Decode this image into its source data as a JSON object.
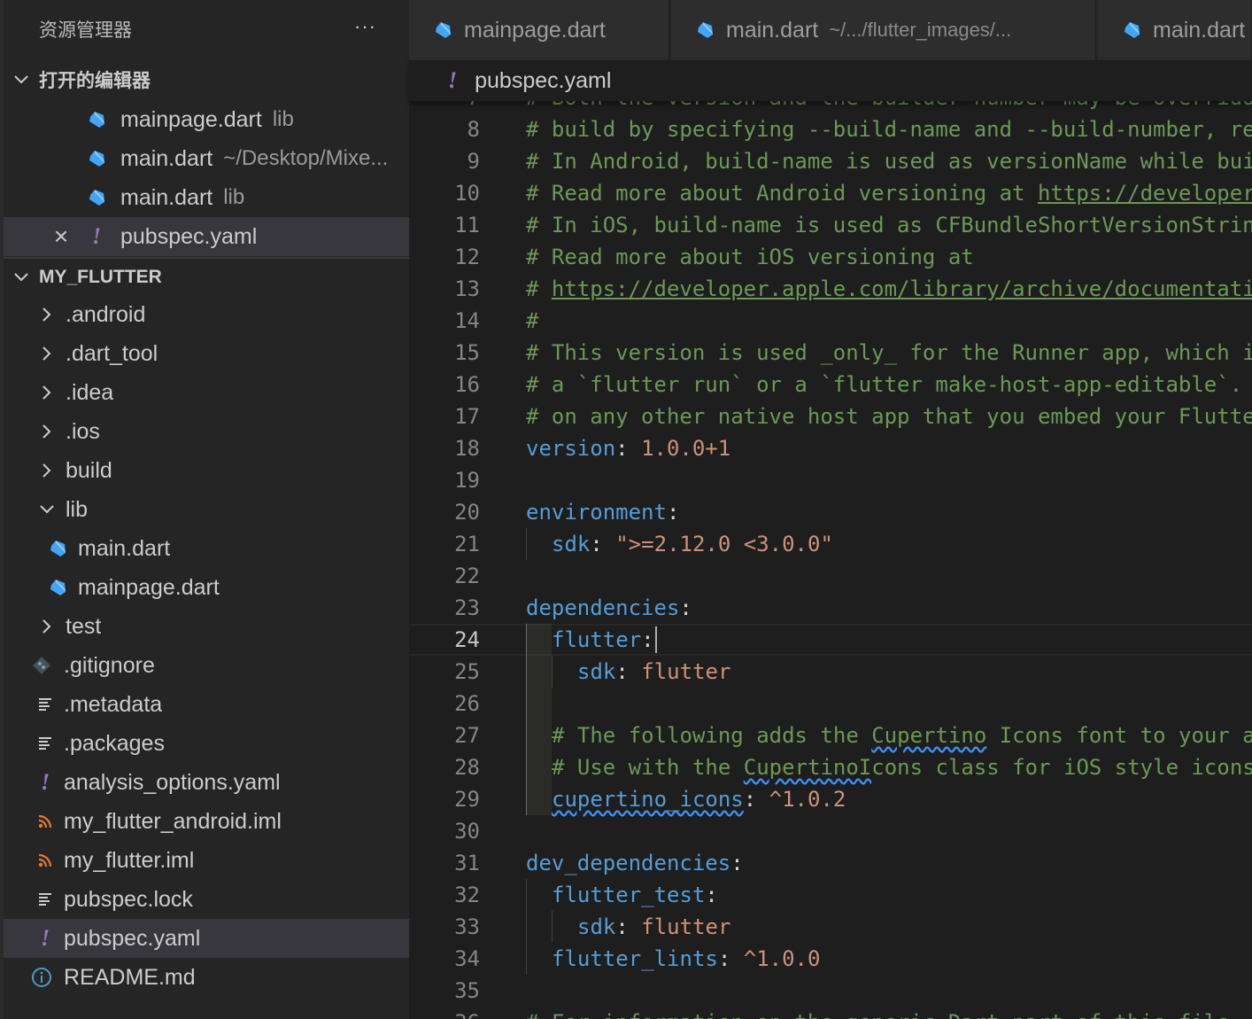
{
  "sidebar": {
    "title": "资源管理器",
    "more": "···",
    "open_editors": {
      "label": "打开的编辑器",
      "items": [
        {
          "name": "mainpage.dart",
          "desc": "lib",
          "icon": "dart-icon"
        },
        {
          "name": "main.dart",
          "desc": "~/Desktop/Mixe...",
          "icon": "dart-icon"
        },
        {
          "name": "main.dart",
          "desc": "lib",
          "icon": "dart-icon"
        },
        {
          "name": "pubspec.yaml",
          "desc": "",
          "icon": "yaml-icon",
          "glyph": "!",
          "close": "×"
        }
      ]
    },
    "project": {
      "label": "MY_FLUTTER",
      "items": [
        {
          "name": ".android",
          "type": "folder"
        },
        {
          "name": ".dart_tool",
          "type": "folder"
        },
        {
          "name": ".idea",
          "type": "folder"
        },
        {
          "name": ".ios",
          "type": "folder"
        },
        {
          "name": "build",
          "type": "folder"
        },
        {
          "name": "lib",
          "type": "folder-open"
        },
        {
          "name": "main.dart",
          "type": "dart"
        },
        {
          "name": "mainpage.dart",
          "type": "dart"
        },
        {
          "name": "test",
          "type": "folder"
        },
        {
          "name": ".gitignore",
          "type": "git"
        },
        {
          "name": ".metadata",
          "type": "lines"
        },
        {
          "name": ".packages",
          "type": "lines"
        },
        {
          "name": "analysis_options.yaml",
          "type": "yaml"
        },
        {
          "name": "my_flutter_android.iml",
          "type": "rss"
        },
        {
          "name": "my_flutter.iml",
          "type": "rss"
        },
        {
          "name": "pubspec.lock",
          "type": "lines"
        },
        {
          "name": "pubspec.yaml",
          "type": "yaml"
        },
        {
          "name": "README.md",
          "type": "info"
        }
      ]
    }
  },
  "tabs": [
    {
      "label": "mainpage.dart",
      "desc": ""
    },
    {
      "label": "main.dart",
      "desc": "~/.../flutter_images/..."
    },
    {
      "label": "main.dart",
      "desc": ""
    }
  ],
  "breadcrumb": {
    "glyph": "!",
    "file": "pubspec.yaml"
  },
  "editor": {
    "lines": [
      {
        "n": "7",
        "code": "# Both the version and the builder number may be overridden"
      },
      {
        "n": "8",
        "code": "# build by specifying --build-name and --build-number, re"
      },
      {
        "n": "9",
        "code": "# In Android, build-name is used as versionName while bui"
      },
      {
        "n": "10",
        "code": "# Read more about Android versioning at ",
        "link": "https://developer"
      },
      {
        "n": "11",
        "code": "# In iOS, build-name is used as CFBundleShortVersionStrin"
      },
      {
        "n": "12",
        "code": "# Read more about iOS versioning at"
      },
      {
        "n": "13",
        "code": "# ",
        "link": "https://developer.apple.com/library/archive/documentati"
      },
      {
        "n": "14",
        "code": "#"
      },
      {
        "n": "15",
        "code": "# This version is used _only_ for the Runner app, which i"
      },
      {
        "n": "16",
        "code": "# a `flutter run` or a `flutter make-host-app-editable`."
      },
      {
        "n": "17",
        "code": "# on any other native host app that you embed your Flutte"
      },
      {
        "n": "18",
        "key": "version",
        "value": "1.0.0+1"
      },
      {
        "n": "19"
      },
      {
        "n": "20",
        "key": "environment"
      },
      {
        "n": "21",
        "key": "sdk",
        "value": "\">=2.12.0 <3.0.0\""
      },
      {
        "n": "22"
      },
      {
        "n": "23",
        "key": "dependencies"
      },
      {
        "n": "24",
        "key": "flutter"
      },
      {
        "n": "25",
        "key": "sdk",
        "value": "flutter"
      },
      {
        "n": "26"
      },
      {
        "n": "27",
        "code": "# The following adds the ",
        "sq": "Cupertino",
        "rest": " Icons font to your a"
      },
      {
        "n": "28",
        "code": "# Use with the ",
        "sq": "CupertinoI",
        "rest": "cons class for iOS style icons"
      },
      {
        "n": "29",
        "key": "cupertino_icons",
        "value": "^1.0.2"
      },
      {
        "n": "30"
      },
      {
        "n": "31",
        "key": "dev_dependencies"
      },
      {
        "n": "32",
        "key": "flutter_test"
      },
      {
        "n": "33",
        "key": "sdk",
        "value": "flutter"
      },
      {
        "n": "34",
        "key": "flutter_lints",
        "value": "^1.0.0"
      },
      {
        "n": "35"
      },
      {
        "n": "36",
        "code": "# For information on the generic Dart part of this file"
      }
    ]
  },
  "colors": {
    "dart_icon": "#42a5f5",
    "yaml_icon": "#a074c4",
    "rss_icon": "#e37933",
    "git_icon": "#41535b",
    "info_icon": "#519aba",
    "comment": "#6a9955",
    "key": "#569cd6",
    "string": "#ce9178"
  }
}
